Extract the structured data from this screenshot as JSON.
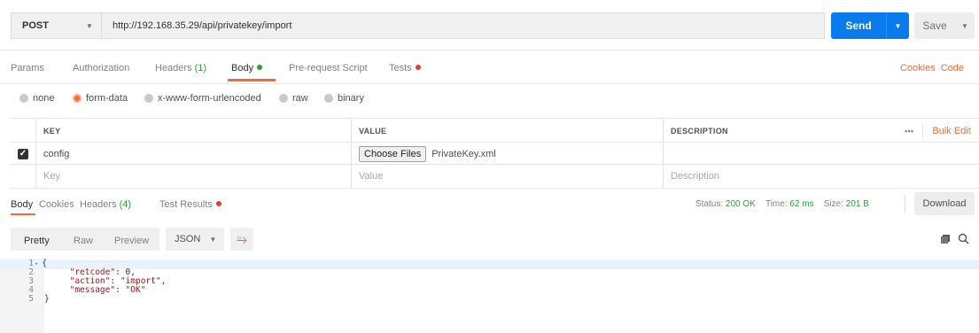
{
  "request": {
    "method": "POST",
    "url": "http://192.168.35.29/api/privatekey/import",
    "send_label": "Send",
    "save_label": "Save"
  },
  "tabs": {
    "params": "Params",
    "authorization": "Authorization",
    "headers": "Headers",
    "headers_count": "(1)",
    "body": "Body",
    "prerequest": "Pre-request Script",
    "tests": "Tests",
    "cookies": "Cookies",
    "code": "Code"
  },
  "body_types": {
    "none": "none",
    "form_data": "form-data",
    "urlencoded": "x-www-form-urlencoded",
    "raw": "raw",
    "binary": "binary",
    "selected": "form-data"
  },
  "table": {
    "headers": {
      "key": "KEY",
      "value": "VALUE",
      "description": "DESCRIPTION",
      "more": "•••",
      "bulk_edit": "Bulk Edit"
    },
    "rows": [
      {
        "checked": true,
        "key": "config",
        "choose_files": "Choose Files",
        "file": "PrivateKey.xml",
        "description": ""
      }
    ],
    "placeholder": {
      "key": "Key",
      "value": "Value",
      "description": "Description"
    }
  },
  "response": {
    "tabs": {
      "body": "Body",
      "cookies": "Cookies",
      "headers": "Headers",
      "headers_count": "(4)",
      "test_results": "Test Results"
    },
    "status_label": "Status:",
    "status_value": "200 OK",
    "time_label": "Time:",
    "time_value": "62 ms",
    "size_label": "Size:",
    "size_value": "201 B",
    "download": "Download"
  },
  "view": {
    "pretty": "Pretty",
    "raw": "Raw",
    "preview": "Preview",
    "format": "JSON"
  },
  "code_lines": [
    {
      "n": "1",
      "text": "{"
    },
    {
      "n": "2",
      "key": "\"retcode\"",
      "sep": ": ",
      "val": "0",
      "end": ","
    },
    {
      "n": "3",
      "key": "\"action\"",
      "sep": ": ",
      "val": "\"import\"",
      "end": ","
    },
    {
      "n": "4",
      "key": "\"message\"",
      "sep": ": ",
      "val": "\"OK\"",
      "end": ""
    },
    {
      "n": "5",
      "text": "}"
    }
  ],
  "colors": {
    "accent": "#f26b3a",
    "send": "#097bed",
    "ok": "#2e9f3a",
    "dirty_dot": "#e53e30"
  }
}
